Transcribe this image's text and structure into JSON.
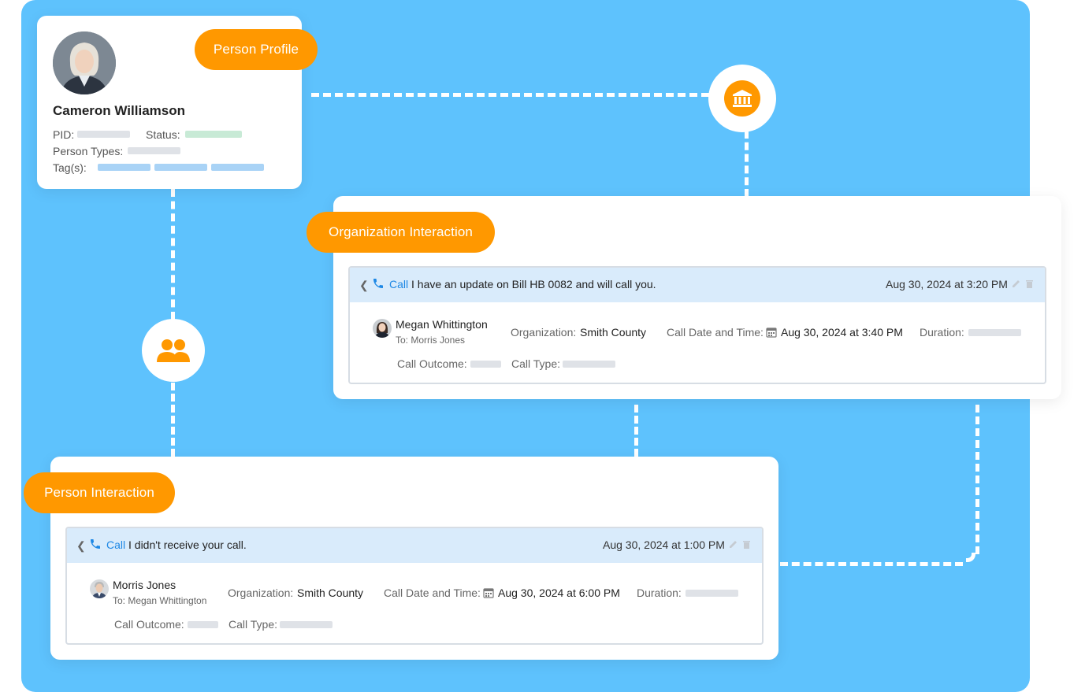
{
  "colors": {
    "background": "#5ec2fd",
    "accent": "#ff9800",
    "link": "#1e88e5",
    "header_fill": "#d9ebfb"
  },
  "profile": {
    "badge": "Person Profile",
    "name": "Cameron Williamson",
    "pid_label": "PID:",
    "status_label": "Status:",
    "person_types_label": "Person Types:",
    "tags_label": "Tag(s):",
    "avatar": "woman-photo-avatar"
  },
  "icons": {
    "organization": "bank-icon",
    "person": "people-icon",
    "phone": "phone-icon",
    "calendar": "calendar-icon",
    "edit": "pencil-icon",
    "delete": "trash-icon",
    "back": "chevron-left-icon"
  },
  "org_interaction": {
    "badge": "Organization Interaction",
    "type_label": "Call",
    "subject": "I have an update on Bill HB 0082 and will call you.",
    "logged_at": "Aug 30, 2024 at 3:20 PM",
    "caller": "Megan Whittington",
    "recipient": "To: Morris Jones",
    "organization_label": "Organization:",
    "organization": "Smith County",
    "call_datetime_label": "Call Date and Time:",
    "call_datetime": "Aug 30, 2024 at 3:40 PM",
    "duration_label": "Duration:",
    "outcome_label": "Call Outcome:",
    "call_type_label": "Call Type:"
  },
  "person_interaction": {
    "badge": "Person Interaction",
    "type_label": "Call",
    "subject": "I didn't receive your call.",
    "logged_at": "Aug 30, 2024 at 1:00 PM",
    "caller": "Morris Jones",
    "recipient": "To: Megan Whittington",
    "organization_label": "Organization:",
    "organization": "Smith County",
    "call_datetime_label": "Call Date and Time:",
    "call_datetime": "Aug 30, 2024 at 6:00 PM",
    "duration_label": "Duration:",
    "outcome_label": "Call Outcome:",
    "call_type_label": "Call Type:"
  }
}
